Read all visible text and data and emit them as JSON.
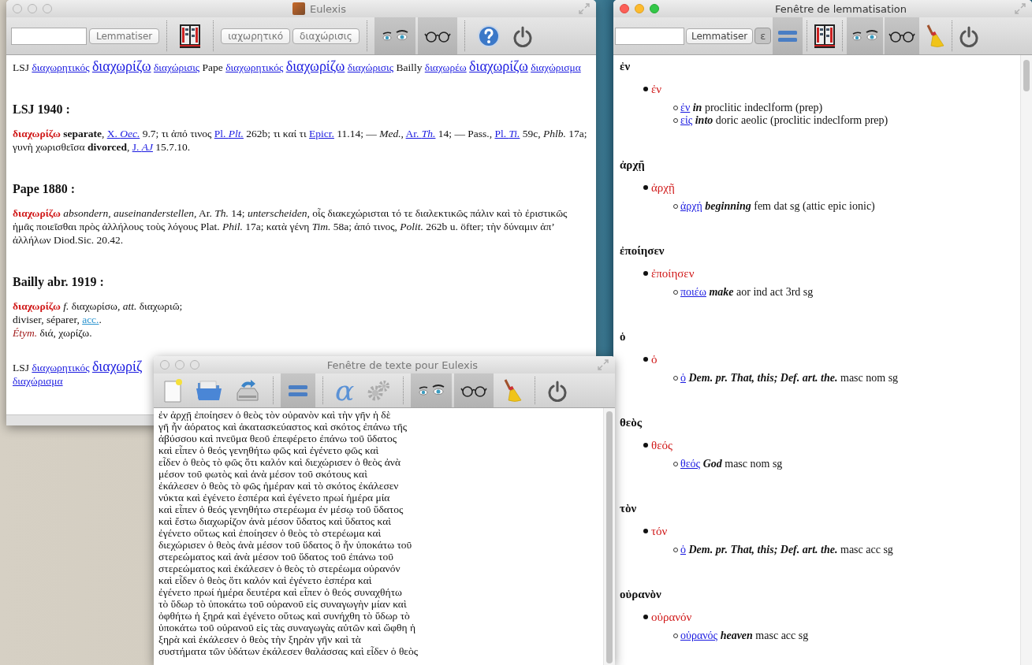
{
  "main_window": {
    "title": "Eulexis",
    "active": false,
    "toolbar": [
      {
        "kind": "field"
      },
      {
        "kind": "button",
        "label": "Lemmatiser",
        "disabled": false
      },
      {
        "kind": "separator"
      },
      {
        "kind": "book",
        "pressed": false
      },
      {
        "kind": "separator"
      },
      {
        "kind": "button",
        "label": "ιαχωρητικό",
        "disabled": false
      },
      {
        "kind": "button",
        "label": "διαχώρισις",
        "disabled": false
      },
      {
        "kind": "separator"
      },
      {
        "kind": "eyes",
        "pressed": true
      },
      {
        "kind": "glasses",
        "pressed": true
      },
      {
        "kind": "separator"
      },
      {
        "kind": "help",
        "pressed": false
      },
      {
        "kind": "power",
        "pressed": false
      }
    ],
    "content": [
      {
        "kind": "links",
        "items": [
          {
            "kind": "label",
            "text": "LSJ"
          },
          {
            "kind": "link",
            "text": "διαχωρητικός"
          },
          {
            "kind": "main",
            "text": "διαχωρίζω"
          },
          {
            "kind": "link",
            "text": "διαχώρισις"
          },
          {
            "kind": "label",
            "text": "Pape"
          },
          {
            "kind": "link",
            "text": "διαχωρητικός"
          },
          {
            "kind": "main",
            "text": "διαχωρίζω"
          },
          {
            "kind": "link",
            "text": "διαχώρισις"
          },
          {
            "kind": "label",
            "text": "Bailly"
          },
          {
            "kind": "link",
            "text": "διαχωρέω"
          },
          {
            "kind": "main",
            "text": "διαχωρίζω"
          },
          {
            "kind": "link",
            "text": "διαχώρισμα"
          }
        ]
      },
      {
        "kind": "heading",
        "text": "LSJ 1940 :"
      },
      {
        "kind": "entry",
        "segments": [
          {
            "kind": "head",
            "text": "διαχωρίζω"
          },
          {
            "kind": "text",
            "text": " **separate**, "
          },
          {
            "kind": "link",
            "text": "X. *Oec.*"
          },
          {
            "kind": "text",
            "text": " 9.7; τι ἀπό τινος "
          },
          {
            "kind": "link",
            "text": "Pl. *Plt.*"
          },
          {
            "kind": "text",
            "text": " 262b; τι καί τι "
          },
          {
            "kind": "link",
            "text": "Epicr."
          },
          {
            "kind": "text",
            "text": " 11.14; — *Med.*, "
          },
          {
            "kind": "link",
            "text": "Ar. *Th.*"
          },
          {
            "kind": "text",
            "text": " 14; — Pass., "
          },
          {
            "kind": "link",
            "text": "Pl. *Ti.*"
          },
          {
            "kind": "text",
            "text": " 59c, *Phlb.* 17a; γυνὴ χωρισθεῖσα **divorced**, "
          },
          {
            "kind": "link",
            "text": "J. *AJ*"
          },
          {
            "kind": "text",
            "text": " 15.7.10."
          }
        ]
      },
      {
        "kind": "heading",
        "text": "Pape 1880 :"
      },
      {
        "kind": "entry",
        "segments": [
          {
            "kind": "head",
            "text": "διαχωρίζω"
          },
          {
            "kind": "text",
            "text": " *absondern, auseinanderstellen,* Ar. *Th.* 14; *unterscheiden,* οἷς διακεχώρισται τό τε διαλεκτικῶς πάλιν καὶ τὸ ἐριστικῶς ἡμᾶς ποιεῖσθαι πρὸς ἀλλήλους τοὺς λόγους Plat. *Phil.* 17a; κατὰ γένη *Tim.* 58a; ἀπό τινος, *Polit.* 262b u. öfter; τὴν δύναμιν ἀπ’ ἀλλήλων Diod.Sic. 20.42."
          }
        ]
      },
      {
        "kind": "heading",
        "text": "Bailly abr. 1919 :"
      },
      {
        "kind": "entry",
        "segments": [
          {
            "kind": "head",
            "text": "διαχωρίζω"
          },
          {
            "kind": "text",
            "text": " *f.* διαχωρίσω, *att.* διαχωριῶ;"
          },
          {
            "kind": "break"
          },
          {
            "kind": "text",
            "text": "diviser, séparer, "
          },
          {
            "kind": "abbr",
            "text": "acc."
          },
          {
            "kind": "text",
            "text": "."
          },
          {
            "kind": "break"
          },
          {
            "kind": "etym",
            "text": "Étym."
          },
          {
            "kind": "text",
            "text": " διά, χωρίζω."
          }
        ]
      },
      {
        "kind": "links",
        "items": [
          {
            "kind": "label",
            "text": "LSJ"
          },
          {
            "kind": "link",
            "text": "διαχωρητικός"
          },
          {
            "kind": "main",
            "text": "διαχωρίζ"
          },
          {
            "kind": "break"
          },
          {
            "kind": "link",
            "text": "διαχώρισμα"
          }
        ]
      }
    ]
  },
  "text_window": {
    "title": "Fenêtre de texte pour Eulexis",
    "active": false,
    "toolbar": [
      {
        "kind": "newdoc",
        "pressed": false
      },
      {
        "kind": "folder",
        "pressed": false
      },
      {
        "kind": "save",
        "pressed": false
      },
      {
        "kind": "separator"
      },
      {
        "kind": "equals",
        "pressed": true
      },
      {
        "kind": "separator"
      },
      {
        "kind": "glyph",
        "label": "α",
        "pressed": false
      },
      {
        "kind": "gears",
        "pressed": false
      },
      {
        "kind": "separator"
      },
      {
        "kind": "eyes",
        "pressed": true
      },
      {
        "kind": "glasses",
        "pressed": true
      },
      {
        "kind": "broom",
        "pressed": false
      },
      {
        "kind": "separator"
      },
      {
        "kind": "power",
        "pressed": false
      }
    ],
    "text": "ἐν ἀρχῇ ἐποίησεν ὁ θεὸς τὸν οὐρανὸν καὶ τὴν γῆν ἡ δὲ\nγῆ ἦν ἀόρατος καὶ ἀκατασκεύαστος καὶ σκότος ἐπάνω τῆς\nἀβύσσου καὶ πνεῦμα θεοῦ ἐπεφέρετο ἐπάνω τοῦ ὕδατος\nκαὶ εἶπεν ὁ θεός γενηθήτω φῶς καὶ ἐγένετο φῶς καὶ\nεἶδεν ὁ θεὸς τὸ φῶς ὅτι καλόν καὶ διεχώρισεν ὁ θεὸς ἀνὰ\nμέσον τοῦ φωτὸς καὶ ἀνὰ μέσον τοῦ σκότους καὶ\nἐκάλεσεν ὁ θεὸς τὸ φῶς ἡμέραν καὶ τὸ σκότος ἐκάλεσεν\nνύκτα καὶ ἐγένετο ἑσπέρα καὶ ἐγένετο πρωί ἡμέρα μία\nκαὶ εἶπεν ὁ θεός γενηθήτω στερέωμα ἐν μέσῳ τοῦ ὕδατος\nκαὶ ἔστω διαχωρίζον ἀνὰ μέσον ὕδατος καὶ ὕδατος καὶ\nἐγένετο οὕτως καὶ ἐποίησεν ὁ θεὸς τὸ στερέωμα καὶ\nδιεχώρισεν ὁ θεὸς ἀνὰ μέσον τοῦ ὕδατος ὃ ἦν ὑποκάτω τοῦ\nστερεώματος καὶ ἀνὰ μέσον τοῦ ὕδατος τοῦ ἐπάνω τοῦ\nστερεώματος καὶ ἐκάλεσεν ὁ θεὸς τὸ στερέωμα οὐρανόν\nκαὶ εἶδεν ὁ θεὸς ὅτι καλόν καὶ ἐγένετο ἑσπέρα καὶ\nἐγένετο πρωί ἡμέρα δευτέρα καὶ εἶπεν ὁ θεός συναχθήτω\nτὸ ὕδωρ τὸ ὑποκάτω τοῦ οὐρανοῦ εἰς συναγωγὴν μίαν καὶ\nὀφθήτω ἡ ξηρά καὶ ἐγένετο οὕτως καὶ συνήχθη τὸ ὕδωρ τὸ\nὑποκάτω τοῦ οὐρανοῦ εἰς τὰς συναγωγὰς αὐτῶν καὶ ὤφθη ἡ\nξηρὰ καὶ ἐκάλεσεν ὁ θεὸς τὴν ξηρὰν γῆν καὶ τὰ\nσυστήματα τῶν ὑδάτων ἐκάλεσεν θαλάσσας καὶ εἶδεν ὁ θεὸς"
  },
  "lemma_window": {
    "title": "Fenêtre de lemmatisation",
    "active": true,
    "toolbar": [
      {
        "kind": "field"
      },
      {
        "kind": "button",
        "label": "Lemmatiser",
        "disabled": false
      },
      {
        "kind": "button",
        "label": "ε",
        "disabled": true
      },
      {
        "kind": "equals",
        "pressed": true
      },
      {
        "kind": "separator"
      },
      {
        "kind": "book",
        "pressed": false
      },
      {
        "kind": "separator"
      },
      {
        "kind": "eyes",
        "pressed": true
      },
      {
        "kind": "glasses",
        "pressed": true
      },
      {
        "kind": "broom",
        "pressed": false
      },
      {
        "kind": "separator"
      },
      {
        "kind": "power",
        "pressed": false
      }
    ],
    "words": [
      {
        "form": "ἐν",
        "lemmas": [
          {
            "form": "ἐν",
            "analyses": [
              {
                "lemma": "ἐν",
                "gloss": "in",
                "morph": "proclitic indeclform (prep)"
              },
              {
                "lemma": "εἰς",
                "gloss": "into",
                "morph": "doric aeolic (proclitic indeclform prep)"
              }
            ]
          }
        ]
      },
      {
        "form": "ἀρχῇ",
        "lemmas": [
          {
            "form": "ἀρχῇ",
            "analyses": [
              {
                "lemma": "ἀρχή",
                "gloss": "beginning",
                "morph": "fem dat sg (attic epic ionic)"
              }
            ]
          }
        ]
      },
      {
        "form": "ἐποίησεν",
        "lemmas": [
          {
            "form": "ἐποίησεν",
            "analyses": [
              {
                "lemma": "ποιέω",
                "gloss": "make",
                "morph": "aor ind act 3rd sg"
              }
            ]
          }
        ]
      },
      {
        "form": "ὁ",
        "lemmas": [
          {
            "form": "ὁ",
            "analyses": [
              {
                "lemma": "ὁ",
                "gloss": "Dem. pr. That, this; Def. art. the.",
                "morph": "masc nom sg"
              }
            ]
          }
        ]
      },
      {
        "form": "θεὸς",
        "lemmas": [
          {
            "form": "θεός",
            "analyses": [
              {
                "lemma": "θεός",
                "gloss": "God",
                "morph": "masc nom sg"
              }
            ]
          }
        ]
      },
      {
        "form": "τὸν",
        "lemmas": [
          {
            "form": "τόν",
            "analyses": [
              {
                "lemma": "ὁ",
                "gloss": "Dem. pr. That, this; Def. art. the.",
                "morph": "masc acc sg"
              }
            ]
          }
        ]
      },
      {
        "form": "οὐρανὸν",
        "lemmas": [
          {
            "form": "οὐρανόν",
            "analyses": [
              {
                "lemma": "οὐρανός",
                "gloss": "heaven",
                "morph": "masc acc sg"
              }
            ]
          }
        ]
      }
    ]
  }
}
